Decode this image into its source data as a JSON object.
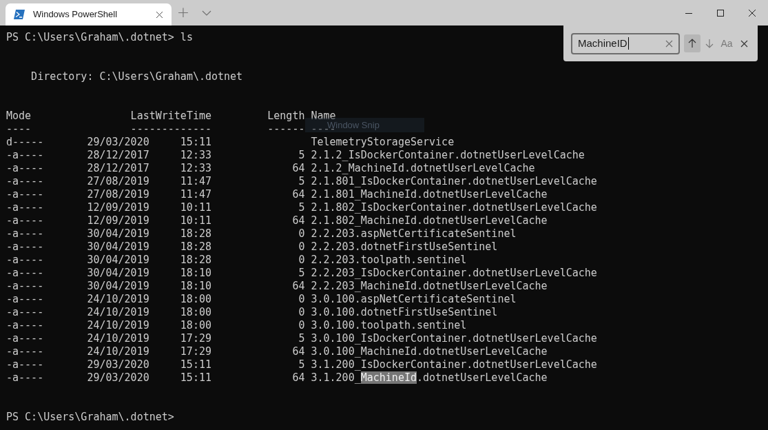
{
  "tabs": [
    {
      "title": "Windows PowerShell",
      "selected": true
    }
  ],
  "new_tab": "+",
  "find": {
    "value": "MachineID",
    "buttons": [
      {
        "kind": "up",
        "highlighted": true
      },
      {
        "kind": "down",
        "highlighted": false
      },
      {
        "kind": "case",
        "label": "Aa",
        "highlighted": false
      },
      {
        "kind": "close",
        "highlighted": false
      }
    ]
  },
  "terminal": {
    "command_line": {
      "prompt": "PS C:\\Users\\Graham\\.dotnet>",
      "command": "ls"
    },
    "directory": "Directory: C:\\Users\\Graham\\.dotnet",
    "columns": [
      "Mode",
      "LastWriteTime",
      "Length",
      "Name"
    ],
    "underlines": [
      "----",
      "-------------",
      "------",
      "----"
    ],
    "rows": [
      {
        "mode": "d-----",
        "date": "29/03/2020",
        "time": "15:11",
        "length": "",
        "name": [
          {
            "text": "TelemetryStorageService",
            "highlighted": false
          }
        ]
      },
      {
        "mode": "-a----",
        "date": "28/12/2017",
        "time": "12:33",
        "length": "5",
        "name": [
          {
            "text": "2.1.2_IsDockerContainer.dotnetUserLevelCache",
            "highlighted": false
          }
        ]
      },
      {
        "mode": "-a----",
        "date": "28/12/2017",
        "time": "12:33",
        "length": "64",
        "name": [
          {
            "text": "2.1.2_MachineId.dotnetUserLevelCache",
            "highlighted": false
          }
        ]
      },
      {
        "mode": "-a----",
        "date": "27/08/2019",
        "time": "11:47",
        "length": "5",
        "name": [
          {
            "text": "2.1.801_IsDockerContainer.dotnetUserLevelCache",
            "highlighted": false
          }
        ]
      },
      {
        "mode": "-a----",
        "date": "27/08/2019",
        "time": "11:47",
        "length": "64",
        "name": [
          {
            "text": "2.1.801_MachineId.dotnetUserLevelCache",
            "highlighted": false
          }
        ]
      },
      {
        "mode": "-a----",
        "date": "12/09/2019",
        "time": "10:11",
        "length": "5",
        "name": [
          {
            "text": "2.1.802_IsDockerContainer.dotnetUserLevelCache",
            "highlighted": false
          }
        ]
      },
      {
        "mode": "-a----",
        "date": "12/09/2019",
        "time": "10:11",
        "length": "64",
        "name": [
          {
            "text": "2.1.802_MachineId.dotnetUserLevelCache",
            "highlighted": false
          }
        ]
      },
      {
        "mode": "-a----",
        "date": "30/04/2019",
        "time": "18:28",
        "length": "0",
        "name": [
          {
            "text": "2.2.203.aspNetCertificateSentinel",
            "highlighted": false
          }
        ]
      },
      {
        "mode": "-a----",
        "date": "30/04/2019",
        "time": "18:28",
        "length": "0",
        "name": [
          {
            "text": "2.2.203.dotnetFirstUseSentinel",
            "highlighted": false
          }
        ]
      },
      {
        "mode": "-a----",
        "date": "30/04/2019",
        "time": "18:28",
        "length": "0",
        "name": [
          {
            "text": "2.2.203.toolpath.sentinel",
            "highlighted": false
          }
        ]
      },
      {
        "mode": "-a----",
        "date": "30/04/2019",
        "time": "18:10",
        "length": "5",
        "name": [
          {
            "text": "2.2.203_IsDockerContainer.dotnetUserLevelCache",
            "highlighted": false
          }
        ]
      },
      {
        "mode": "-a----",
        "date": "30/04/2019",
        "time": "18:10",
        "length": "64",
        "name": [
          {
            "text": "2.2.203_MachineId.dotnetUserLevelCache",
            "highlighted": false
          }
        ]
      },
      {
        "mode": "-a----",
        "date": "24/10/2019",
        "time": "18:00",
        "length": "0",
        "name": [
          {
            "text": "3.0.100.aspNetCertificateSentinel",
            "highlighted": false
          }
        ]
      },
      {
        "mode": "-a----",
        "date": "24/10/2019",
        "time": "18:00",
        "length": "0",
        "name": [
          {
            "text": "3.0.100.dotnetFirstUseSentinel",
            "highlighted": false
          }
        ]
      },
      {
        "mode": "-a----",
        "date": "24/10/2019",
        "time": "18:00",
        "length": "0",
        "name": [
          {
            "text": "3.0.100.toolpath.sentinel",
            "highlighted": false
          }
        ]
      },
      {
        "mode": "-a----",
        "date": "24/10/2019",
        "time": "17:29",
        "length": "5",
        "name": [
          {
            "text": "3.0.100_IsDockerContainer.dotnetUserLevelCache",
            "highlighted": false
          }
        ]
      },
      {
        "mode": "-a----",
        "date": "24/10/2019",
        "time": "17:29",
        "length": "64",
        "name": [
          {
            "text": "3.0.100_MachineId.dotnetUserLevelCache",
            "highlighted": false
          }
        ]
      },
      {
        "mode": "-a----",
        "date": "29/03/2020",
        "time": "15:11",
        "length": "5",
        "name": [
          {
            "text": "3.1.200_IsDockerContainer.dotnetUserLevelCache",
            "highlighted": false
          }
        ]
      },
      {
        "mode": "-a----",
        "date": "29/03/2020",
        "time": "15:11",
        "length": "64",
        "name": [
          {
            "text": "3.1.200_",
            "highlighted": false
          },
          {
            "text": "MachineId",
            "highlighted": true
          },
          {
            "text": ".dotnetUserLevelCache",
            "highlighted": false
          }
        ]
      }
    ],
    "final_prompt": "PS C:\\Users\\Graham\\.dotnet>"
  },
  "tooltip": "Window Snip"
}
